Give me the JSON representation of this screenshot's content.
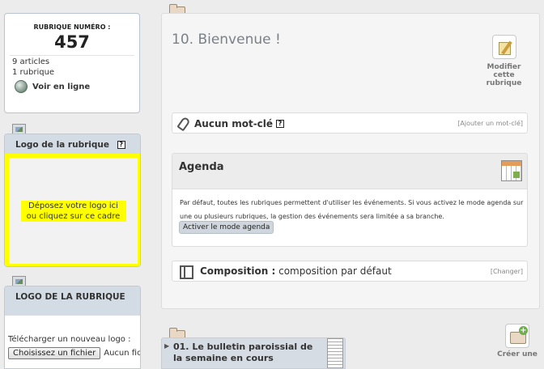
{
  "info": {
    "number_label": "RUBRIQUE NUMÉRO :",
    "number": "457",
    "articles": "9 articles",
    "rubriques": "1 rubrique",
    "online_label": "Voir en ligne"
  },
  "logo_panel": {
    "title": "Logo de la rubrique",
    "help": "?",
    "dropzone_text": "Déposez votre logo ici ou cliquez sur ce cadre"
  },
  "logo_panel2": {
    "title": "LOGO DE LA RUBRIQUE",
    "upload_label": "Télécharger un nouveau logo :",
    "choose_button": "Choisissez un fichier",
    "no_file": "Aucun fichier choisi"
  },
  "main": {
    "title": "10. Bienvenue !",
    "edit_label": "Modifier cette rubrique"
  },
  "keywords": {
    "title": "Aucun mot-clé",
    "help": "?",
    "add_link": "[Ajouter un mot-clé]"
  },
  "agenda": {
    "title": "Agenda",
    "text": "Par défaut, toutes les rubriques permettent d'utiliser les événements. Si vous activez le mode agenda sur une ou plusieurs rubriques, la gestion des événements sera limitée a sa branche.",
    "button": "Activer le mode agenda"
  },
  "composition": {
    "label": "Composition :",
    "value": "composition par défaut",
    "change_link": "[Changer]"
  },
  "subrubrique": {
    "title": "01. Le bulletin paroissial de la semaine en cours"
  },
  "create": {
    "label": "Créer une"
  }
}
